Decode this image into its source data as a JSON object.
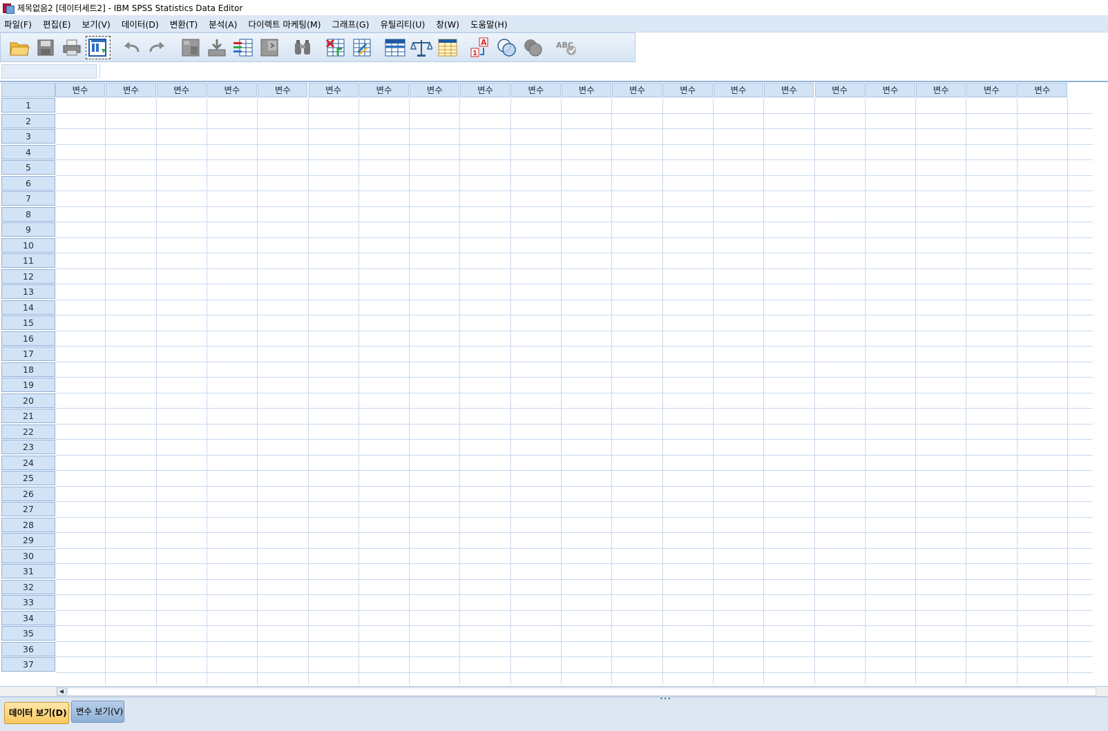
{
  "window": {
    "title": "제목없음2 [데이터세트2] - IBM SPSS Statistics Data Editor"
  },
  "menu": [
    {
      "label": "파일(F)",
      "name": "menu-file"
    },
    {
      "label": "편집(E)",
      "name": "menu-edit"
    },
    {
      "label": "보기(V)",
      "name": "menu-view"
    },
    {
      "label": "데이터(D)",
      "name": "menu-data"
    },
    {
      "label": "변환(T)",
      "name": "menu-transform"
    },
    {
      "label": "분석(A)",
      "name": "menu-analyze"
    },
    {
      "label": "다이렉트 마케팅(M)",
      "name": "menu-direct-marketing"
    },
    {
      "label": "그래프(G)",
      "name": "menu-graphs"
    },
    {
      "label": "유틸리티(U)",
      "name": "menu-utilities"
    },
    {
      "label": "창(W)",
      "name": "menu-window"
    },
    {
      "label": "도움말(H)",
      "name": "menu-help"
    }
  ],
  "toolbar": [
    {
      "icon": "open-folder-icon"
    },
    {
      "icon": "save-icon"
    },
    {
      "icon": "print-icon"
    },
    {
      "icon": "recall-dialog-icon"
    },
    {
      "icon": "undo-icon"
    },
    {
      "icon": "redo-icon"
    },
    {
      "icon": "goto-case-icon"
    },
    {
      "icon": "goto-variable-icon"
    },
    {
      "icon": "variables-icon"
    },
    {
      "icon": "run-descriptives-icon"
    },
    {
      "icon": "find-binoculars-icon"
    },
    {
      "icon": "insert-cases-icon"
    },
    {
      "icon": "insert-variable-icon"
    },
    {
      "icon": "split-file-icon"
    },
    {
      "icon": "weight-cases-icon"
    },
    {
      "icon": "select-cases-icon"
    },
    {
      "icon": "value-labels-icon"
    },
    {
      "icon": "use-variable-sets-icon"
    },
    {
      "icon": "show-all-variables-icon"
    },
    {
      "icon": "spell-check-icon"
    }
  ],
  "grid": {
    "column_header_label": "변수",
    "column_count": 20,
    "rows": [
      "1",
      "2",
      "3",
      "4",
      "5",
      "6",
      "7",
      "8",
      "9",
      "10",
      "11",
      "12",
      "13",
      "14",
      "15",
      "16",
      "17",
      "18",
      "19",
      "20",
      "21",
      "22",
      "23",
      "24",
      "25",
      "26",
      "27",
      "28",
      "29",
      "30",
      "31",
      "32",
      "33",
      "34",
      "35",
      "36",
      "37"
    ]
  },
  "tabs": {
    "data_view": "데이터 보기(D)",
    "variable_view": "변수 보기(V)"
  },
  "colors": {
    "header_bg": "#d3e3f6",
    "grid_line": "#c7d8ec",
    "active_tab": "#f7c760",
    "menubar_bg": "#dce8f5"
  }
}
